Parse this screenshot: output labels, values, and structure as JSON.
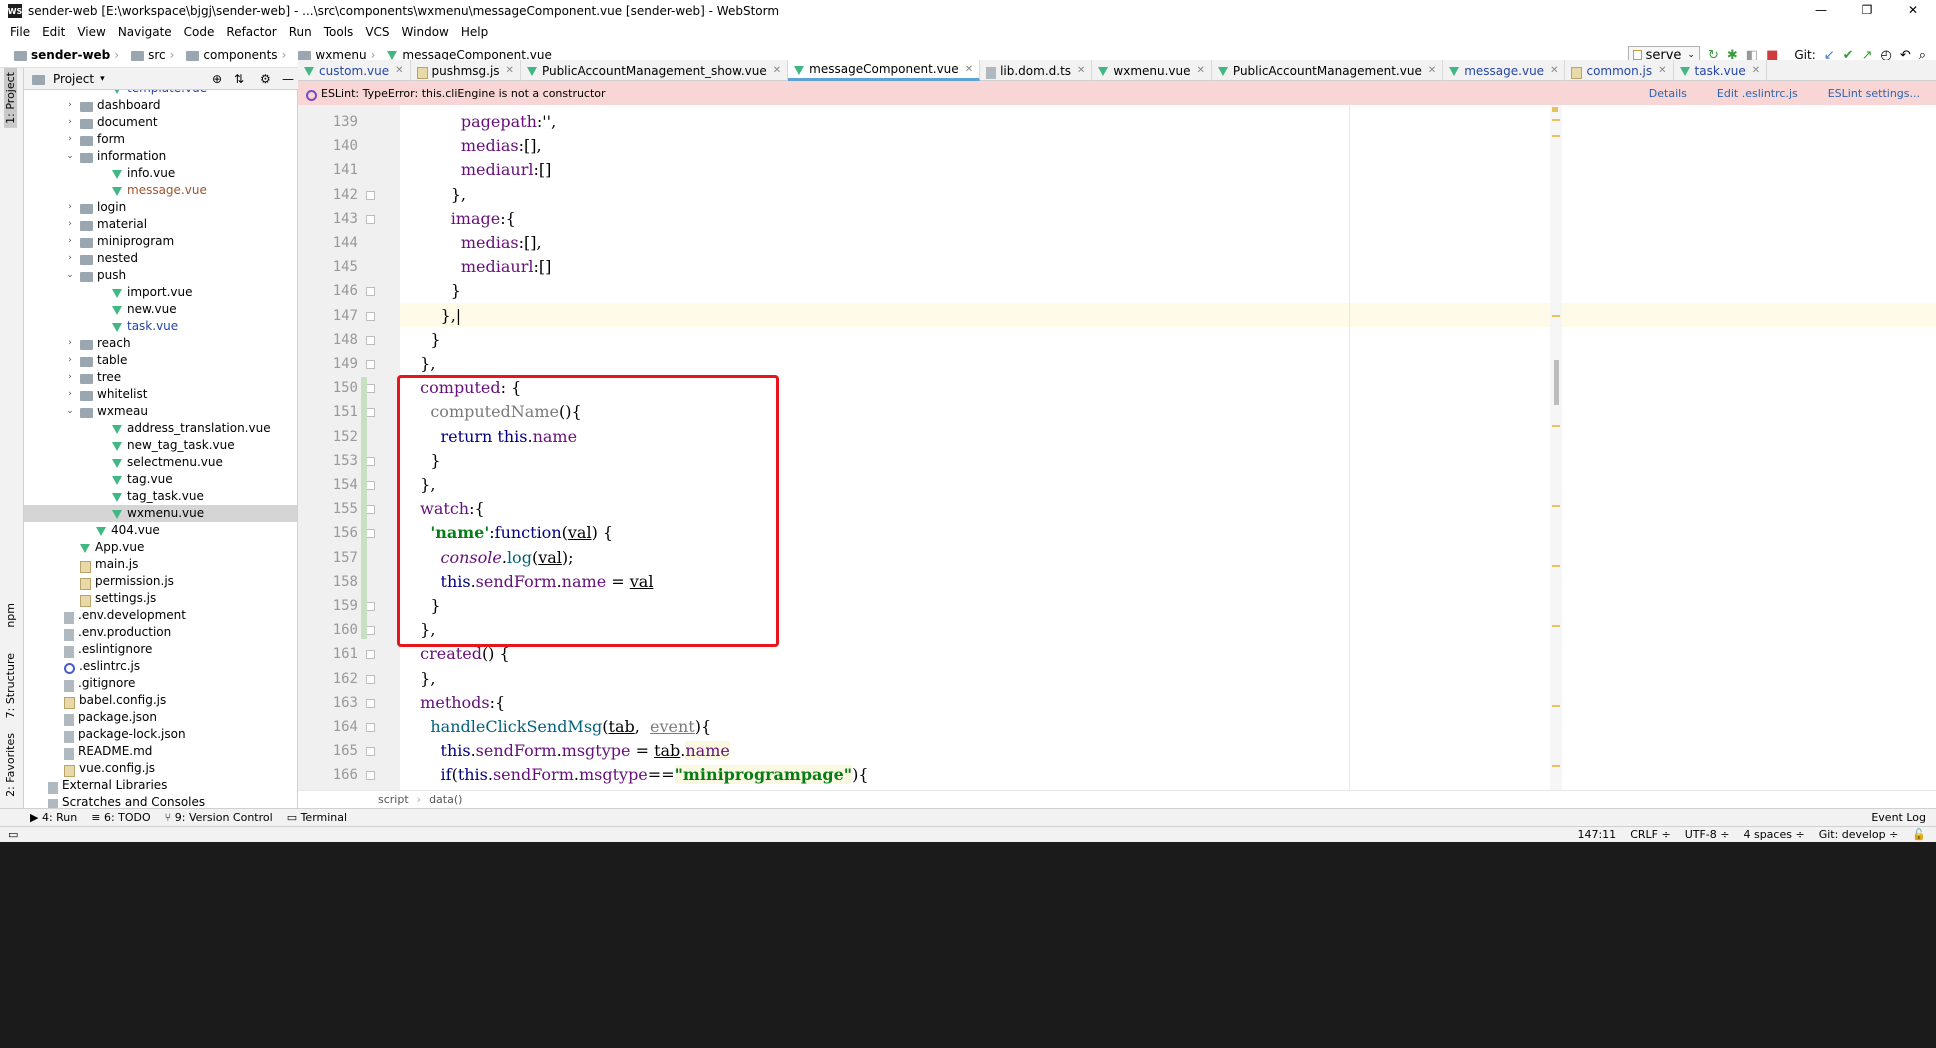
{
  "window": {
    "title": "sender-web [E:\\workspace\\bjgj\\sender-web] - ...\\src\\components\\wxmenu\\messageComponent.vue [sender-web] - WebStorm",
    "app_icon": "WS",
    "minimize": "—",
    "restore": "❐",
    "close": "✕"
  },
  "menu": [
    "File",
    "Edit",
    "View",
    "Navigate",
    "Code",
    "Refactor",
    "Run",
    "Tools",
    "VCS",
    "Window",
    "Help"
  ],
  "breadcrumb": [
    "sender-web",
    "src",
    "components",
    "wxmenu",
    "messageComponent.vue"
  ],
  "toolbar": {
    "run_config": "serve",
    "git_label": "Git:"
  },
  "sidebar_tabs": {
    "project": "1: Project",
    "npm": "npm",
    "structure": "7: Structure",
    "favorites": "2: Favorites"
  },
  "project_panel": {
    "title": "Project"
  },
  "tree": [
    {
      "label": "template.vue",
      "indent": 5,
      "icon": "vue",
      "arrow": "",
      "cls": "vcsblue"
    },
    {
      "label": "dashboard",
      "indent": 3,
      "icon": "folder",
      "arrow": "›",
      "cls": ""
    },
    {
      "label": "document",
      "indent": 3,
      "icon": "folder",
      "arrow": "›",
      "cls": ""
    },
    {
      "label": "form",
      "indent": 3,
      "icon": "folder",
      "arrow": "›",
      "cls": ""
    },
    {
      "label": "information",
      "indent": 3,
      "icon": "folder",
      "arrow": "⌄",
      "cls": ""
    },
    {
      "label": "info.vue",
      "indent": 5,
      "icon": "vue",
      "arrow": "",
      "cls": ""
    },
    {
      "label": "message.vue",
      "indent": 5,
      "icon": "vue",
      "arrow": "",
      "cls": "modified"
    },
    {
      "label": "login",
      "indent": 3,
      "icon": "folder",
      "arrow": "›",
      "cls": ""
    },
    {
      "label": "material",
      "indent": 3,
      "icon": "folder",
      "arrow": "›",
      "cls": ""
    },
    {
      "label": "miniprogram",
      "indent": 3,
      "icon": "folder",
      "arrow": "›",
      "cls": ""
    },
    {
      "label": "nested",
      "indent": 3,
      "icon": "folder",
      "arrow": "›",
      "cls": ""
    },
    {
      "label": "push",
      "indent": 3,
      "icon": "folder",
      "arrow": "⌄",
      "cls": ""
    },
    {
      "label": "import.vue",
      "indent": 5,
      "icon": "vue",
      "arrow": "",
      "cls": ""
    },
    {
      "label": "new.vue",
      "indent": 5,
      "icon": "vue",
      "arrow": "",
      "cls": ""
    },
    {
      "label": "task.vue",
      "indent": 5,
      "icon": "vue",
      "arrow": "",
      "cls": "vcsblue"
    },
    {
      "label": "reach",
      "indent": 3,
      "icon": "folder",
      "arrow": "›",
      "cls": ""
    },
    {
      "label": "table",
      "indent": 3,
      "icon": "folder",
      "arrow": "›",
      "cls": ""
    },
    {
      "label": "tree",
      "indent": 3,
      "icon": "folder",
      "arrow": "›",
      "cls": ""
    },
    {
      "label": "whitelist",
      "indent": 3,
      "icon": "folder",
      "arrow": "›",
      "cls": ""
    },
    {
      "label": "wxmeau",
      "indent": 3,
      "icon": "folder",
      "arrow": "⌄",
      "cls": ""
    },
    {
      "label": "address_translation.vue",
      "indent": 5,
      "icon": "vue",
      "arrow": "",
      "cls": ""
    },
    {
      "label": "new_tag_task.vue",
      "indent": 5,
      "icon": "vue",
      "arrow": "",
      "cls": ""
    },
    {
      "label": "selectmenu.vue",
      "indent": 5,
      "icon": "vue",
      "arrow": "",
      "cls": ""
    },
    {
      "label": "tag.vue",
      "indent": 5,
      "icon": "vue",
      "arrow": "",
      "cls": ""
    },
    {
      "label": "tag_task.vue",
      "indent": 5,
      "icon": "vue",
      "arrow": "",
      "cls": ""
    },
    {
      "label": "wxmenu.vue",
      "indent": 5,
      "icon": "vue",
      "arrow": "",
      "cls": "",
      "selected": true
    },
    {
      "label": "404.vue",
      "indent": 4,
      "icon": "vue",
      "arrow": "",
      "cls": ""
    },
    {
      "label": "App.vue",
      "indent": 3,
      "icon": "vue",
      "arrow": "",
      "cls": ""
    },
    {
      "label": "main.js",
      "indent": 3,
      "icon": "js",
      "arrow": "",
      "cls": ""
    },
    {
      "label": "permission.js",
      "indent": 3,
      "icon": "js",
      "arrow": "",
      "cls": ""
    },
    {
      "label": "settings.js",
      "indent": 3,
      "icon": "js",
      "arrow": "",
      "cls": ""
    },
    {
      "label": ".env.development",
      "indent": 2,
      "icon": "file",
      "arrow": "",
      "cls": ""
    },
    {
      "label": ".env.production",
      "indent": 2,
      "icon": "file",
      "arrow": "",
      "cls": ""
    },
    {
      "label": ".eslintignore",
      "indent": 2,
      "icon": "file",
      "arrow": "",
      "cls": ""
    },
    {
      "label": ".eslintrc.js",
      "indent": 2,
      "icon": "circle",
      "arrow": "",
      "cls": ""
    },
    {
      "label": ".gitignore",
      "indent": 2,
      "icon": "file",
      "arrow": "",
      "cls": ""
    },
    {
      "label": "babel.config.js",
      "indent": 2,
      "icon": "js",
      "arrow": "",
      "cls": ""
    },
    {
      "label": "package.json",
      "indent": 2,
      "icon": "file",
      "arrow": "",
      "cls": ""
    },
    {
      "label": "package-lock.json",
      "indent": 2,
      "icon": "file",
      "arrow": "",
      "cls": ""
    },
    {
      "label": "README.md",
      "indent": 2,
      "icon": "file",
      "arrow": "",
      "cls": ""
    },
    {
      "label": "vue.config.js",
      "indent": 2,
      "icon": "js",
      "arrow": "",
      "cls": ""
    },
    {
      "label": "External Libraries",
      "indent": 1,
      "icon": "file",
      "arrow": "",
      "cls": ""
    },
    {
      "label": "Scratches and Consoles",
      "indent": 1,
      "icon": "file",
      "arrow": "",
      "cls": ""
    }
  ],
  "tabs": [
    {
      "label": "custom.vue",
      "icon": "vue",
      "active": false,
      "cls": "vcsblue"
    },
    {
      "label": "pushmsg.js",
      "icon": "js",
      "active": false,
      "cls": ""
    },
    {
      "label": "PublicAccountManagement_show.vue",
      "icon": "vue",
      "active": false,
      "cls": ""
    },
    {
      "label": "messageComponent.vue",
      "icon": "vue",
      "active": true,
      "cls": ""
    },
    {
      "label": "lib.dom.d.ts",
      "icon": "file",
      "active": false,
      "cls": ""
    },
    {
      "label": "wxmenu.vue",
      "icon": "vue",
      "active": false,
      "cls": ""
    },
    {
      "label": "PublicAccountManagement.vue",
      "icon": "vue",
      "active": false,
      "cls": ""
    },
    {
      "label": "message.vue",
      "icon": "vue",
      "active": false,
      "cls": "vcsblue"
    },
    {
      "label": "common.js",
      "icon": "js",
      "active": false,
      "cls": "vcsblue"
    },
    {
      "label": "task.vue",
      "icon": "vue",
      "active": false,
      "cls": "vcsblue"
    }
  ],
  "eslint": {
    "message": "ESLint: TypeError: this.cliEngine is not a constructor",
    "details": "Details",
    "edit": "Edit .eslintrc.js",
    "settings": "ESLint settings..."
  },
  "code": [
    {
      "n": "139",
      "html": "          <span class='pr'>pagepath</span>:'',"
    },
    {
      "n": "140",
      "html": "          <span class='pr'>medias</span>:[],"
    },
    {
      "n": "141",
      "html": "          <span class='pr'>mediaurl</span>:[]"
    },
    {
      "n": "142",
      "html": "        },"
    },
    {
      "n": "143",
      "html": "        <span class='pr'>image</span>:{"
    },
    {
      "n": "144",
      "html": "          <span class='pr'>medias</span>:[],"
    },
    {
      "n": "145",
      "html": "          <span class='pr'>mediaurl</span>:[]"
    },
    {
      "n": "146",
      "html": "        }"
    },
    {
      "n": "147",
      "html": "      },|"
    },
    {
      "n": "148",
      "html": "    }"
    },
    {
      "n": "149",
      "html": "  },"
    },
    {
      "n": "150",
      "html": "  <span class='pr'>computed</span>: {"
    },
    {
      "n": "151",
      "html": "    <span class='fn' style='color:#7a7a7a'>computedName</span>(){"
    },
    {
      "n": "152",
      "html": "      <span class='kw'>return</span> <span class='kw'>this</span>.<span class='pr'>name</span>"
    },
    {
      "n": "153",
      "html": "    }"
    },
    {
      "n": "154",
      "html": "  },"
    },
    {
      "n": "155",
      "html": "  <span class='pr'>watch</span>:{"
    },
    {
      "n": "156",
      "html": "    <span class='st'>'name'</span>:<span class='kw'>function</span>(<span class='ul'>val</span>) {"
    },
    {
      "n": "157",
      "html": "      <span class='it'>console</span>.<span class='fn'>log</span>(<span class='ul'>val</span>);"
    },
    {
      "n": "158",
      "html": "      <span class='kw'>this</span>.<span class='pr'>sendForm</span>.<span class='pr'>name</span> = <span class='ul'>val</span>"
    },
    {
      "n": "159",
      "html": "    }"
    },
    {
      "n": "160",
      "html": "  },"
    },
    {
      "n": "161",
      "html": "  <span class='pr'>created</span>() {"
    },
    {
      "n": "162",
      "html": "  },"
    },
    {
      "n": "163",
      "html": "  <span class='pr'>methods</span>:{"
    },
    {
      "n": "164",
      "html": "    <span class='fn'>handleClickSendMsg</span>(<span class='ul'>tab</span>,  <span class='ul' style='color:#7a7a7a'>event</span>){"
    },
    {
      "n": "165",
      "html": "      <span class='kw'>this</span>.<span class='pr'>sendForm</span>.<span class='pr'>msgtype</span> = <span class='ul'>tab</span>.<span class='pr hl'>name</span>"
    },
    {
      "n": "166",
      "html": "      <span class='kw'>if</span>(<span class='kw'>this</span>.<span class='pr'>sendForm</span>.<span class='pr'>msgtype</span>==<span class='st hl'>\"miniprogrampage\"</span>){"
    }
  ],
  "code_crumb": [
    "script",
    "data()"
  ],
  "bottom_tabs": [
    "▶ 4: Run",
    "≡ 6: TODO",
    "⑂ 9: Version Control",
    "▭ Terminal"
  ],
  "event_log": "Event Log",
  "status": {
    "position": "147:11",
    "line_sep": "CRLF ÷",
    "encoding": "UTF-8 ÷",
    "indent": "4 spaces ÷",
    "git": "Git: develop ÷"
  }
}
